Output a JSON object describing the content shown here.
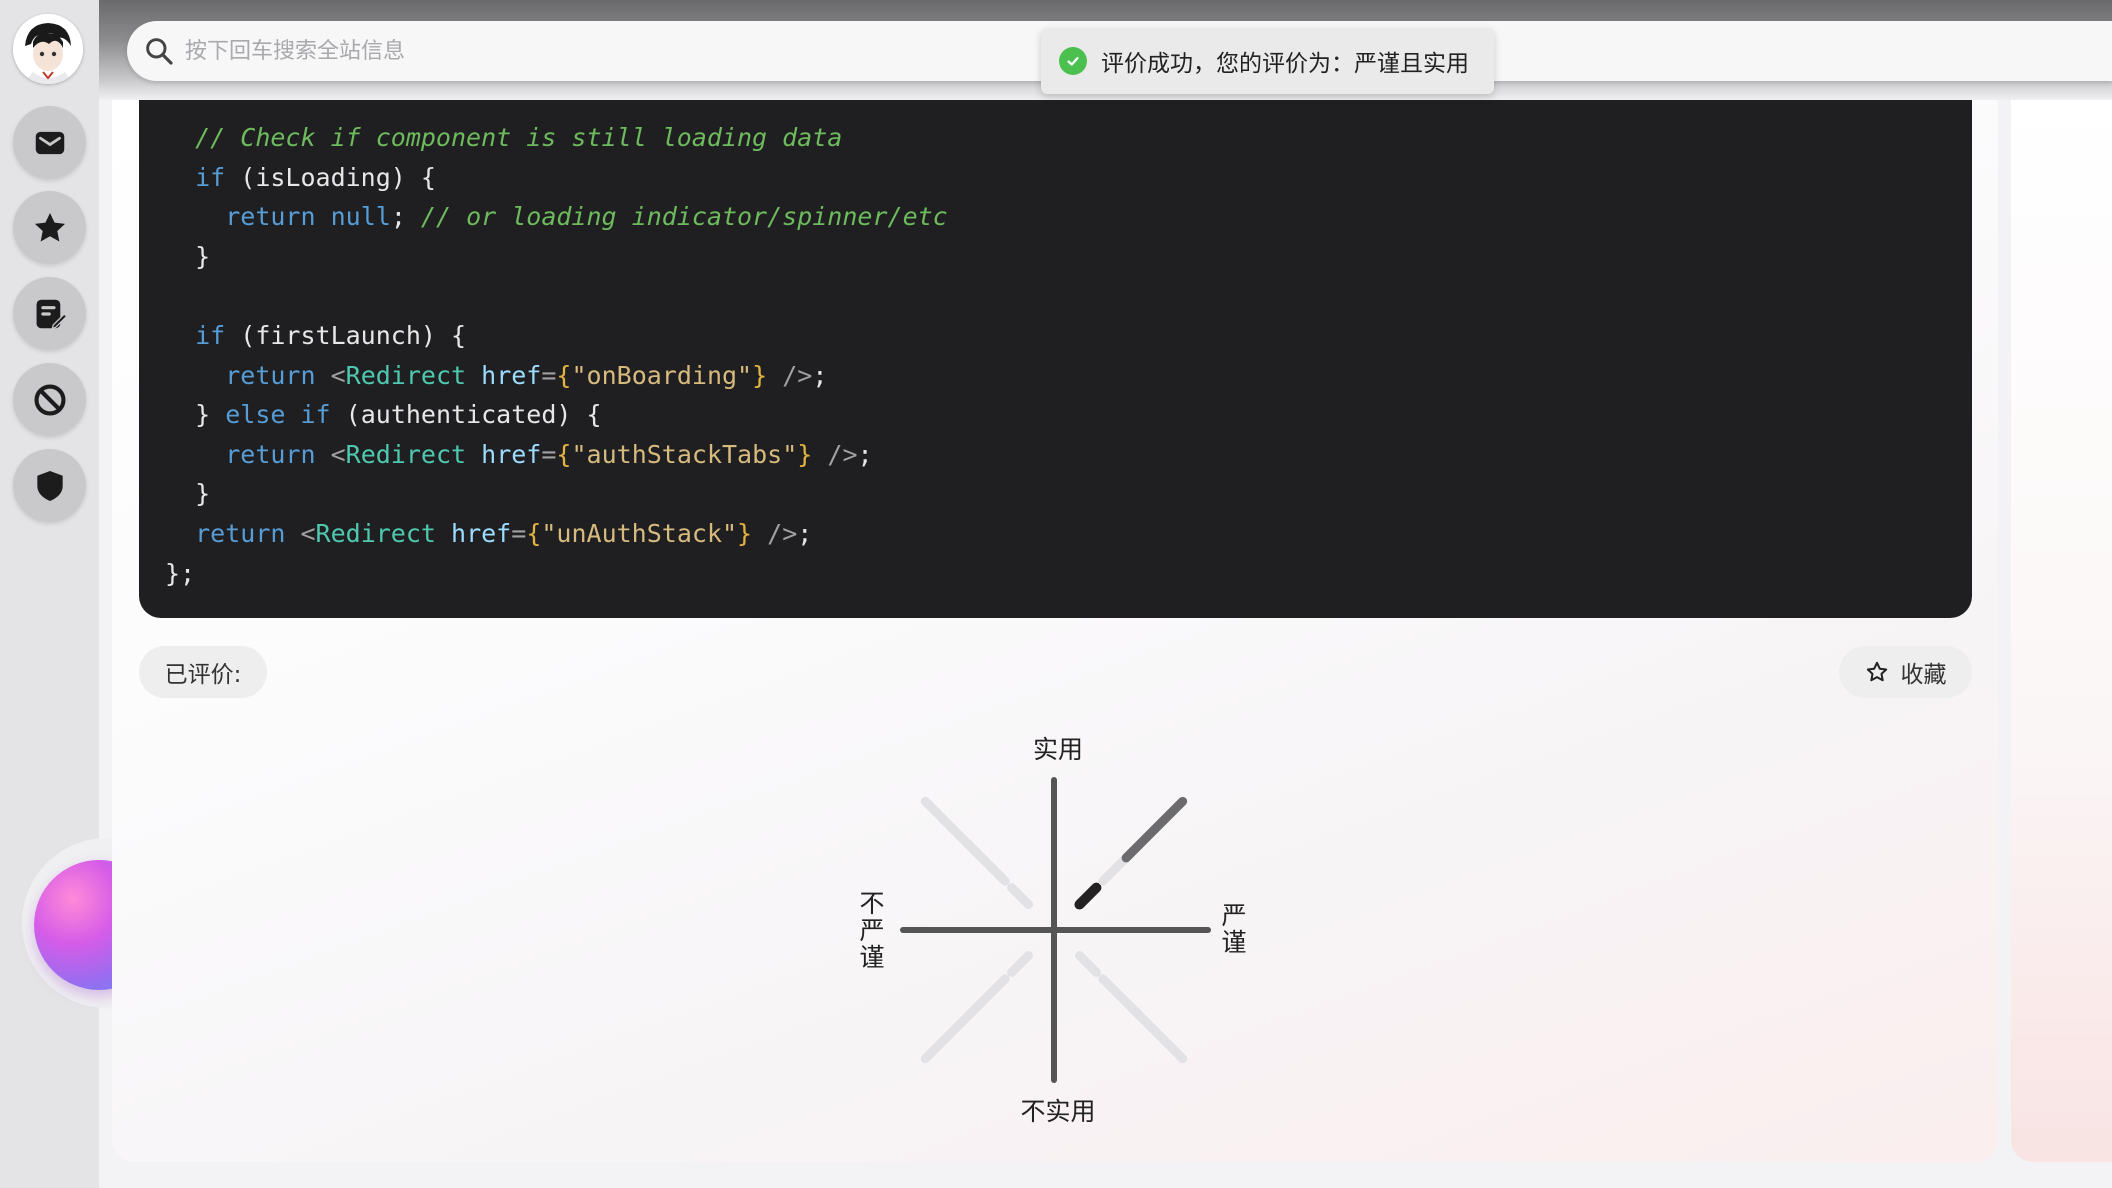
{
  "search": {
    "placeholder": "按下回车搜索全站信息"
  },
  "toast": {
    "text": "评价成功，您的评价为：严谨且实用"
  },
  "rail": {
    "items": [
      {
        "icon": "mail-icon"
      },
      {
        "icon": "star-icon"
      },
      {
        "icon": "edit-note-icon"
      },
      {
        "icon": "ban-icon"
      },
      {
        "icon": "shield-icon"
      }
    ]
  },
  "code": {
    "lines": [
      "// Check if component is still loading data",
      "if (isLoading) {",
      "  return null; // or loading indicator/spinner/etc",
      "}",
      "",
      "if (firstLaunch) {",
      "  return <Redirect href={\"onBoarding\"} />;",
      "} else if (authenticated) {",
      "  return <Redirect href={\"authStackTabs\"} />;",
      "}",
      "return <Redirect href={\"unAuthStack\"} />;",
      "};"
    ]
  },
  "rating": {
    "rated_label": "已评价:",
    "favorite_label": "收藏",
    "axis_top": "实用",
    "axis_bottom": "不实用",
    "axis_left": "不严谨",
    "axis_right": "严谨",
    "selected": {
      "quadrant": "top-right",
      "level": 1
    }
  },
  "colors": {
    "toast_success": "#4cc04f",
    "code_background": "#1f1f21",
    "selected_segment": "#222222",
    "axis": "#555555"
  }
}
